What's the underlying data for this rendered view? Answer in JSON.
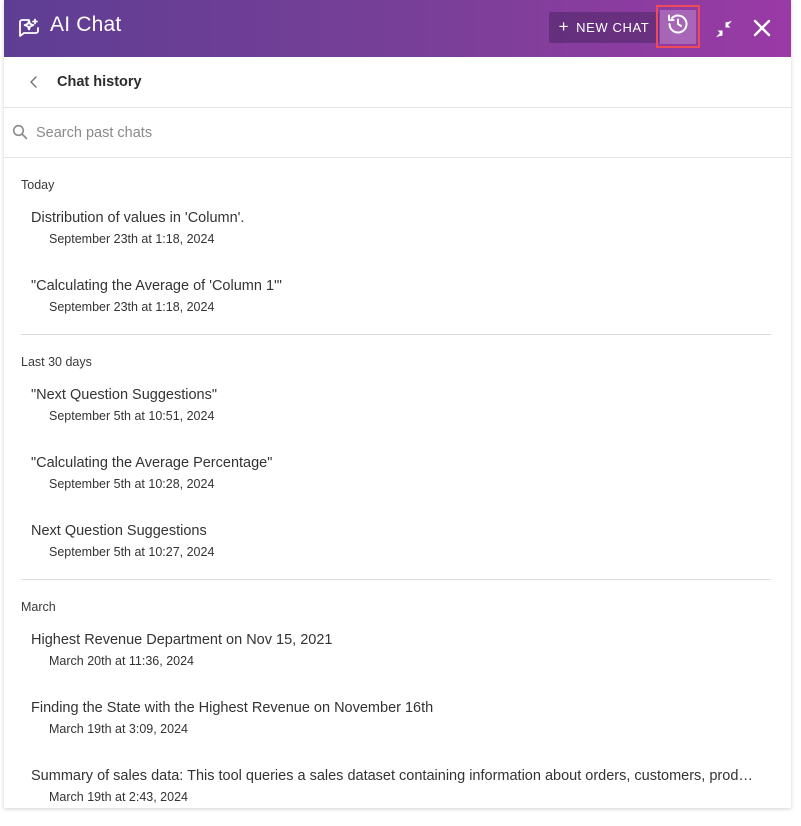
{
  "header": {
    "title": "AI Chat",
    "new_chat_label": "NEW CHAT",
    "accent_start": "#5e3e93",
    "accent_end": "#9a3aa6",
    "highlight_color": "#ef4a5a"
  },
  "icons": {
    "app": "chat-sparkle-icon",
    "history": "history-clock-icon",
    "collapse": "collapse-arrows-icon",
    "close": "close-icon",
    "back": "chevron-left-icon",
    "search": "search-icon"
  },
  "subheader": {
    "title": "Chat history"
  },
  "search": {
    "placeholder": "Search past chats",
    "value": ""
  },
  "groups": [
    {
      "label": "Today",
      "items": [
        {
          "title": "Distribution of values in 'Column'.",
          "date": "September 23th at 1:18, 2024"
        },
        {
          "title": "\"Calculating the Average of 'Column 1'\"",
          "date": "September 23th at 1:18, 2024"
        }
      ]
    },
    {
      "label": "Last 30 days",
      "items": [
        {
          "title": "\"Next Question Suggestions\"",
          "date": "September 5th at 10:51, 2024"
        },
        {
          "title": "\"Calculating the Average Percentage\"",
          "date": "September 5th at 10:28, 2024"
        },
        {
          "title": "Next Question Suggestions",
          "date": "September 5th at 10:27, 2024"
        }
      ]
    },
    {
      "label": "March",
      "items": [
        {
          "title": "Highest Revenue Department on Nov 15, 2021",
          "date": "March 20th at 11:36, 2024"
        },
        {
          "title": "Finding the State with the Highest Revenue on November 16th",
          "date": "March 19th at 3:09, 2024"
        },
        {
          "title": "Summary of sales data: This tool queries a sales dataset containing information about orders, customers, products, and more",
          "date": "March 19th at 2:43, 2024"
        }
      ]
    }
  ]
}
